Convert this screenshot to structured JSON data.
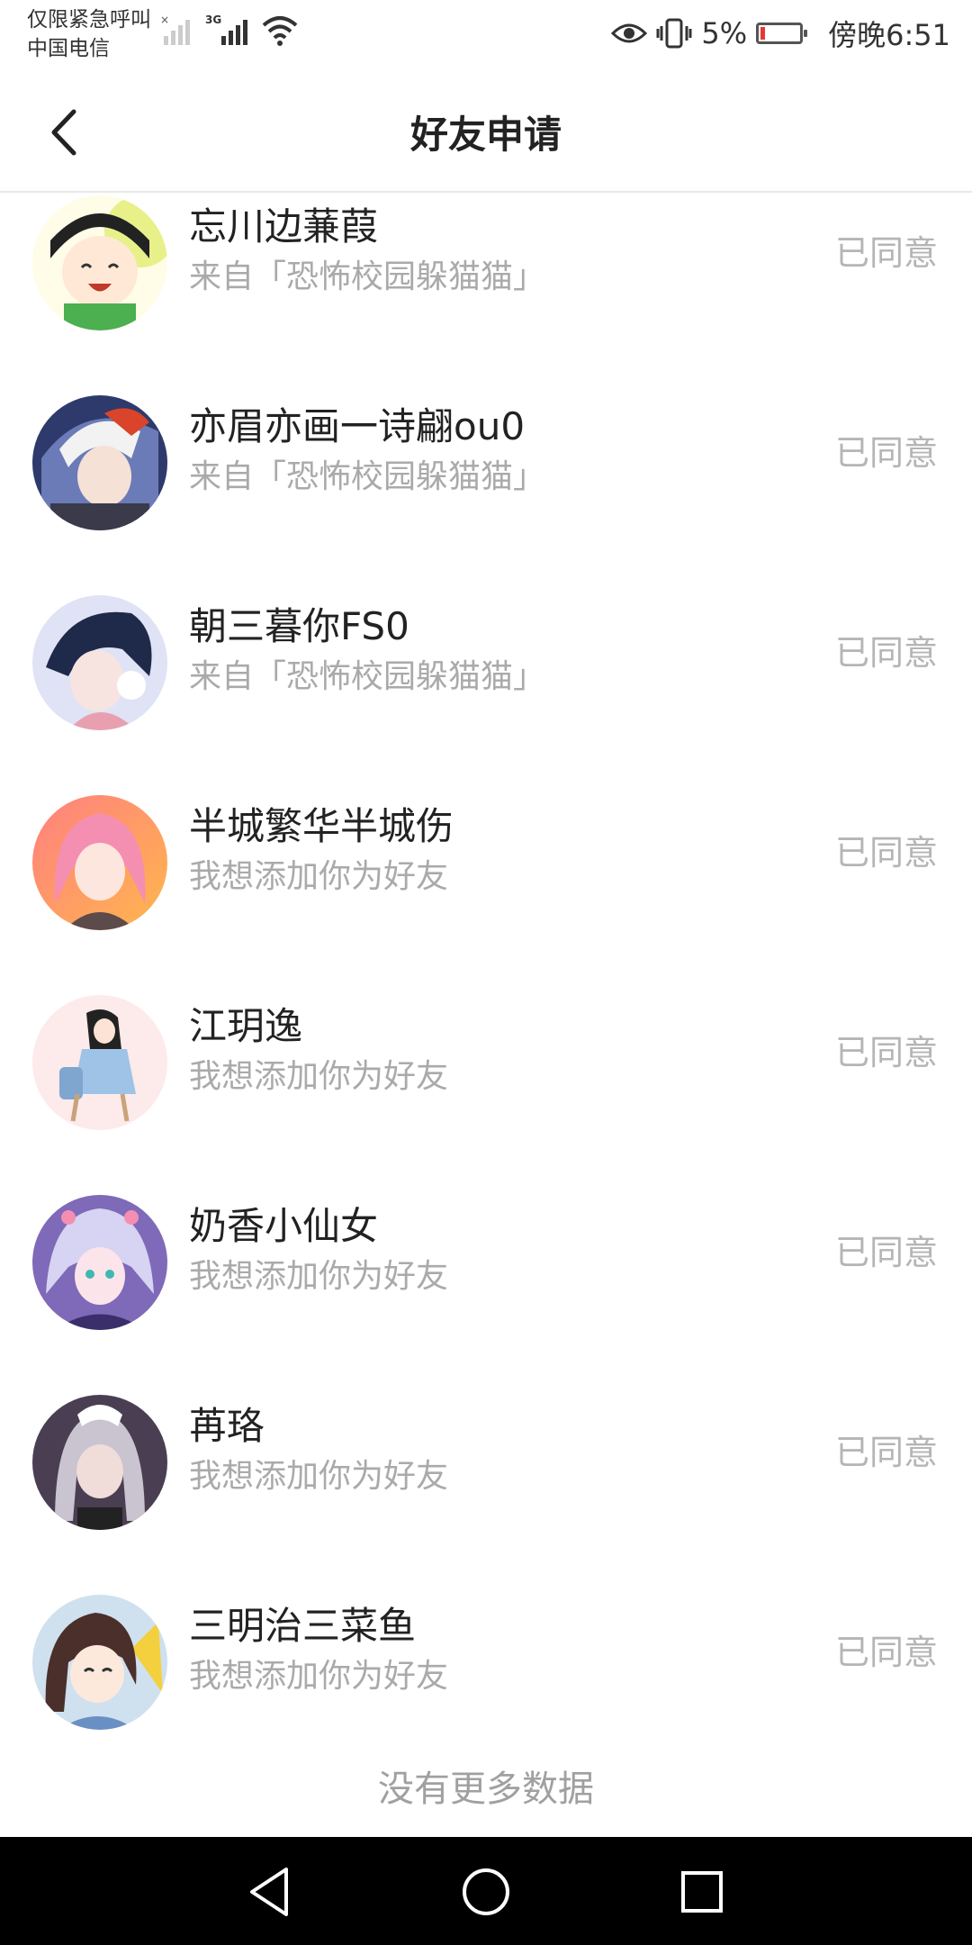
{
  "status_bar": {
    "carrier_line1": "仅限紧急呼叫",
    "carrier_line2": "中国电信",
    "network": "3G",
    "battery": "5%",
    "time": "傍晚6:51"
  },
  "header": {
    "title": "好友申请"
  },
  "requests": [
    {
      "name": "忘川边蒹葭",
      "source": "来自「恐怖校园躲猫猫」",
      "status": "已同意"
    },
    {
      "name": "亦眉亦画一诗翩ou0",
      "source": "来自「恐怖校园躲猫猫」",
      "status": "已同意"
    },
    {
      "name": "朝三暮你FS0",
      "source": "来自「恐怖校园躲猫猫」",
      "status": "已同意"
    },
    {
      "name": "半城繁华半城伤",
      "source": "我想添加你为好友",
      "status": "已同意"
    },
    {
      "name": "江玥逸",
      "source": "我想添加你为好友",
      "status": "已同意"
    },
    {
      "name": "奶香小仙女",
      "source": "我想添加你为好友",
      "status": "已同意"
    },
    {
      "name": "苒珞",
      "source": "我想添加你为好友",
      "status": "已同意"
    },
    {
      "name": "三明治三菜鱼",
      "source": "我想添加你为好友",
      "status": "已同意"
    }
  ],
  "footer": {
    "no_more": "没有更多数据"
  }
}
